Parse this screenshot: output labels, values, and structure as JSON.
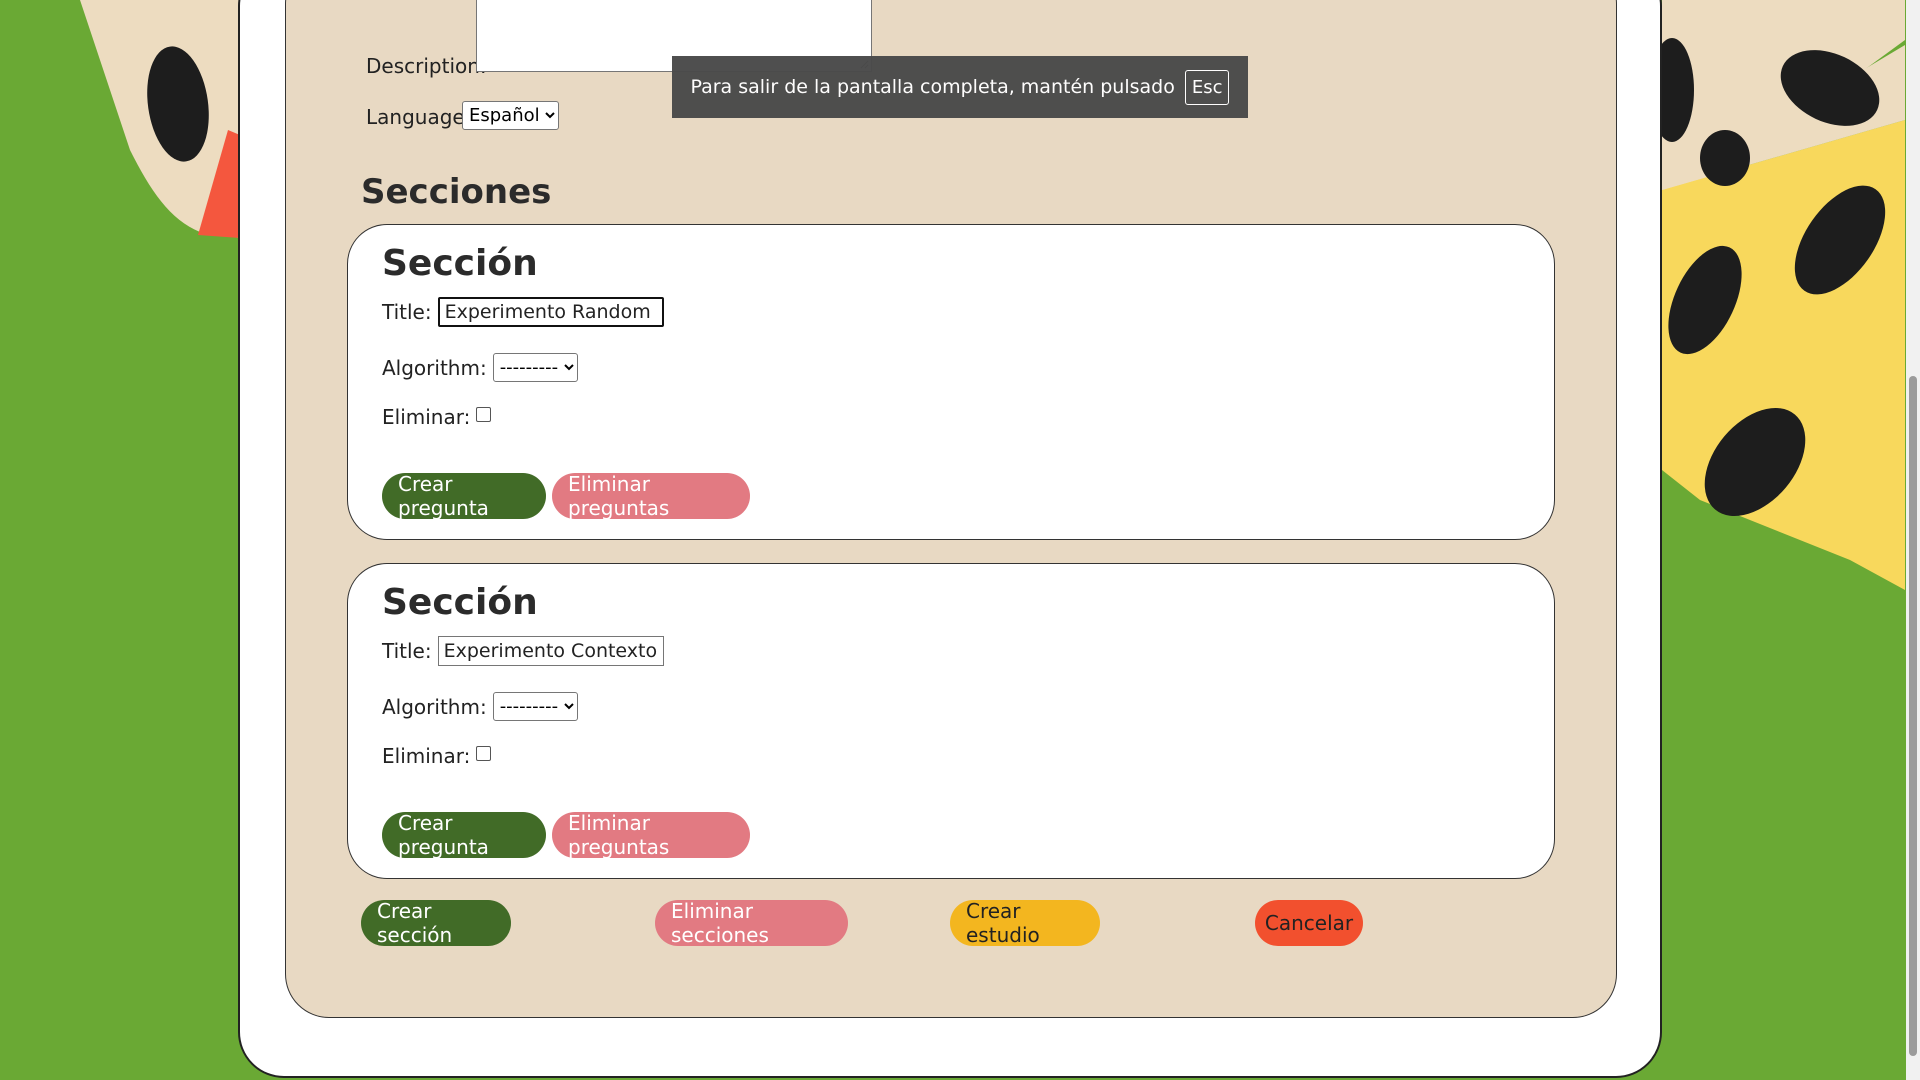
{
  "form": {
    "description_label": "Description:",
    "language_label": "Language:",
    "language_value": "Español"
  },
  "fullscreen_toast": {
    "message": "Para salir de la pantalla completa, mantén pulsado",
    "key": "Esc"
  },
  "sections_heading": "Secciones",
  "sections": [
    {
      "heading": "Sección",
      "title_label": "Title:",
      "title_value": "Experimento Random",
      "algorithm_label": "Algorithm:",
      "algorithm_value": "---------",
      "delete_label": "Eliminar:",
      "create_question": "Crear pregunta",
      "delete_questions": "Eliminar preguntas"
    },
    {
      "heading": "Sección",
      "title_label": "Title:",
      "title_value": "Experimento Contexto",
      "algorithm_label": "Algorithm:",
      "algorithm_value": "---------",
      "delete_label": "Eliminar:",
      "create_question": "Crear pregunta",
      "delete_questions": "Eliminar preguntas"
    }
  ],
  "actions": {
    "create_section": "Crear sección",
    "delete_sections": "Eliminar secciones",
    "create_study": "Crear estudio",
    "cancel": "Cancelar"
  },
  "colors": {
    "background_green": "#6aa934",
    "panel_beige": "#e8d9c3",
    "button_green": "#416b27",
    "button_pink": "#e27a82",
    "button_yellow": "#f3b61f",
    "button_red": "#f2502e"
  }
}
